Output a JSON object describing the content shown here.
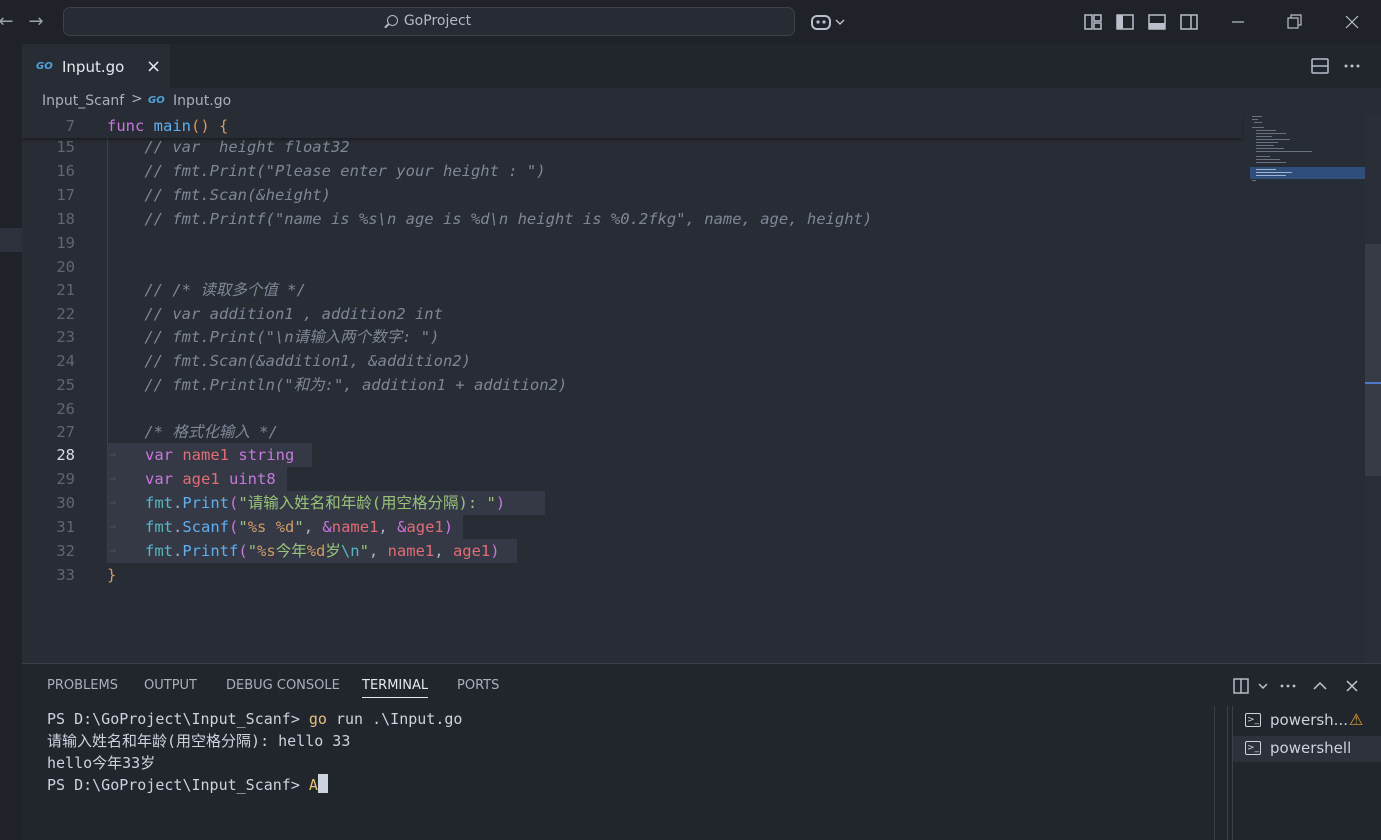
{
  "titlebar": {
    "search_text": "GoProject",
    "back_icon": "←",
    "forward_icon": "→",
    "copilot_icon": "copilot-icon"
  },
  "tabs": [
    {
      "badge": "GO",
      "label": "Input.go",
      "close": "×"
    }
  ],
  "breadcrumb": {
    "folder": "Input_Scanf",
    "separator": ">",
    "badge": "GO",
    "file": "Input.go"
  },
  "editor": {
    "sticky_line": {
      "number": "7",
      "text": "func main() {"
    },
    "lines": [
      {
        "number": "15",
        "text": "    // var  height float32"
      },
      {
        "number": "16",
        "text": "    // fmt.Print(\"Please enter your height : \")"
      },
      {
        "number": "17",
        "text": "    // fmt.Scan(&height)"
      },
      {
        "number": "18",
        "text": "    // fmt.Printf(\"name is %s\\n age is %d\\n height is %0.2fkg\", name, age, height)"
      },
      {
        "number": "19",
        "text": ""
      },
      {
        "number": "20",
        "text": ""
      },
      {
        "number": "21",
        "text": "    // /* 读取多个值 */"
      },
      {
        "number": "22",
        "text": "    // var addition1 , addition2 int"
      },
      {
        "number": "23",
        "text": "    // fmt.Print(\"\\n请输入两个数字: \")"
      },
      {
        "number": "24",
        "text": "    // fmt.Scan(&addition1, &addition2)"
      },
      {
        "number": "25",
        "text": "    // fmt.Println(\"和为:\", addition1 + addition2)"
      },
      {
        "number": "26",
        "text": ""
      },
      {
        "number": "27",
        "text": "    /* 格式化输入 */"
      },
      {
        "number": "28",
        "text": "var name1 string"
      },
      {
        "number": "29",
        "text": "var age1 uint8"
      },
      {
        "number": "30",
        "text": "fmt.Print(\"请输入姓名和年龄(用空格分隔): \")"
      },
      {
        "number": "31",
        "text": "fmt.Scanf(\"%s %d\", &name1, &age1)"
      },
      {
        "number": "32",
        "text": "fmt.Printf(\"%s今年%d岁\\n\", name1, age1)"
      },
      {
        "number": "33",
        "text": "}"
      }
    ],
    "active_line": "28"
  },
  "panel": {
    "tabs": [
      "PROBLEMS",
      "OUTPUT",
      "DEBUG CONSOLE",
      "TERMINAL",
      "PORTS"
    ],
    "active_tab": "TERMINAL",
    "terminal": {
      "prompt1": "PS D:\\GoProject\\Input_Scanf> ",
      "cmd_go": "go",
      "cmd_rest": " run .\\Input.go",
      "out1": "请输入姓名和年龄(用空格分隔): hello 33",
      "out2": "hello今年33岁",
      "prompt2": "PS D:\\GoProject\\Input_Scanf> ",
      "ghost": "A"
    },
    "terminal_list": [
      {
        "label": "powersh...",
        "warning": true
      },
      {
        "label": "powershell",
        "warning": false
      }
    ]
  },
  "colors": {
    "keyword": "#c678dd",
    "function": "#61afef",
    "variable": "#e06c75",
    "type": "#e5c07b",
    "string": "#98c379",
    "comment": "#7f8796"
  }
}
